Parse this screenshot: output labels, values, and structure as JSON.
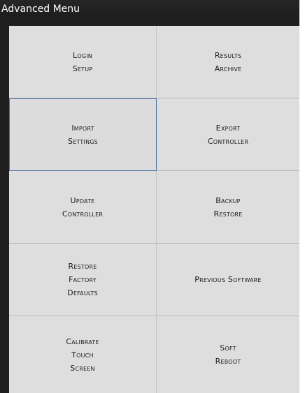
{
  "window": {
    "title": "Advanced Menu"
  },
  "menu": {
    "buttons": [
      {
        "lines": [
          "Login",
          "Setup"
        ]
      },
      {
        "lines": [
          "Results",
          "Archive"
        ]
      },
      {
        "lines": [
          "Import",
          "Settings"
        ]
      },
      {
        "lines": [
          "Export",
          "Controller"
        ]
      },
      {
        "lines": [
          "Update",
          "Controller"
        ]
      },
      {
        "lines": [
          "Backup",
          "Restore"
        ]
      },
      {
        "lines": [
          "Restore",
          "Factory",
          "Defaults"
        ]
      },
      {
        "lines": [
          "Previous Software"
        ]
      },
      {
        "lines": [
          "Calibrate",
          "Touch",
          "Screen"
        ]
      },
      {
        "lines": [
          "Soft",
          "Reboot"
        ]
      }
    ]
  }
}
